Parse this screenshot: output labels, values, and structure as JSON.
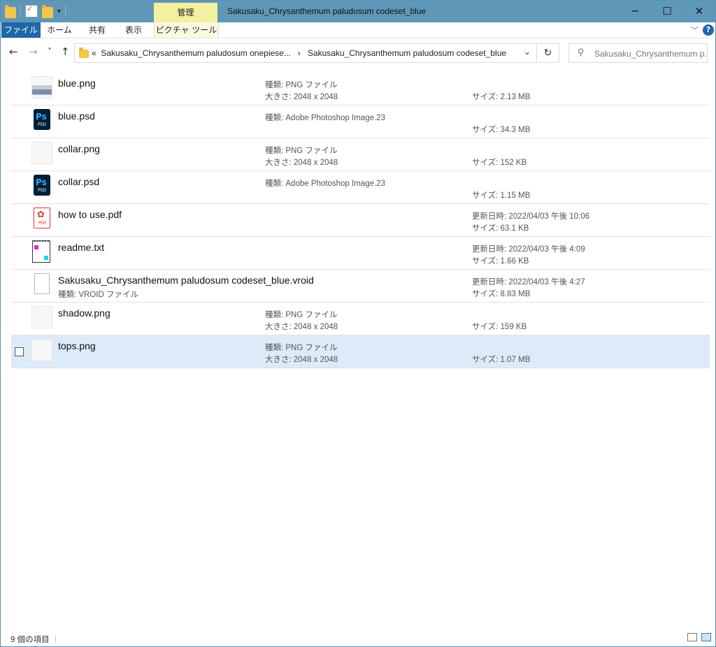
{
  "window": {
    "title": "Sakusaku_Chrysanthemum paludosum codeset_blue",
    "manage_tab": "管理",
    "caption_buttons": {
      "minimize": "─",
      "maximize": "☐",
      "close": "✕"
    }
  },
  "ribbon": {
    "tabs": [
      {
        "label": "ファイル"
      },
      {
        "label": "ホーム"
      },
      {
        "label": "共有"
      },
      {
        "label": "表示"
      },
      {
        "label": "ピクチャ ツール"
      }
    ],
    "help": "?"
  },
  "nav": {
    "back": "←",
    "forward": "→",
    "recent": "˅",
    "up": "↑",
    "breadcrumbs": {
      "overflow": "«",
      "parent": "Sakusaku_Chrysanthemum paludosum onepiese...",
      "separator": "›",
      "current": "Sakusaku_Chrysanthemum paludosum codeset_blue"
    },
    "refresh": "↻",
    "search_placeholder": "Sakusaku_Chrysanthemum p..."
  },
  "files": [
    {
      "name": "blue.png",
      "icon": "png-thumbnail-icon",
      "type": "種類: PNG ファイル",
      "dims": "大きさ: 2048 x 2048",
      "date": "",
      "size": "サイズ: 2.13 MB",
      "selected": false
    },
    {
      "name": "blue.psd",
      "icon": "photoshop-icon",
      "type": "種類: Adobe Photoshop Image.23",
      "dims": "",
      "date": "",
      "size": "サイズ: 34.3 MB",
      "selected": false
    },
    {
      "name": "collar.png",
      "icon": "png-thumbnail-icon",
      "type": "種類: PNG ファイル",
      "dims": "大きさ: 2048 x 2048",
      "date": "",
      "size": "サイズ: 152 KB",
      "selected": false
    },
    {
      "name": "collar.psd",
      "icon": "photoshop-icon",
      "type": "種類: Adobe Photoshop Image.23",
      "dims": "",
      "date": "",
      "size": "サイズ: 1.15 MB",
      "selected": false
    },
    {
      "name": "how to use.pdf",
      "icon": "pdf-icon",
      "type": "",
      "dims": "",
      "date": "更新日時: 2022/04/03 午後 10:06",
      "size": "サイズ: 63.1 KB",
      "selected": false
    },
    {
      "name": "readme.txt",
      "icon": "text-file-icon",
      "type": "",
      "dims": "",
      "date": "更新日時: 2022/04/03 午後 4:09",
      "size": "サイズ: 1.66 KB",
      "selected": false
    },
    {
      "name": "Sakusaku_Chrysanthemum paludosum codeset_blue.vroid",
      "icon": "generic-file-icon",
      "subtype": "種類: VROID ファイル",
      "type": "",
      "dims": "",
      "date": "更新日時: 2022/04/03 午後 4:27",
      "size": "サイズ: 8.83 MB",
      "selected": false
    },
    {
      "name": "shadow.png",
      "icon": "png-thumbnail-icon",
      "type": "種類: PNG ファイル",
      "dims": "大きさ: 2048 x 2048",
      "date": "",
      "size": "サイズ: 159 KB",
      "selected": false
    },
    {
      "name": "tops.png",
      "icon": "png-thumbnail-icon",
      "type": "種類: PNG ファイル",
      "dims": "大きさ: 2048 x 2048",
      "date": "",
      "size": "サイズ: 1.07 MB",
      "selected": true
    }
  ],
  "status": {
    "count": "9 個の項目"
  },
  "colors": {
    "titlebar": "#5f97b8",
    "file_tab": "#1f67a8",
    "manage_tab": "#f3f0a0",
    "selection": "#dcebf7"
  }
}
